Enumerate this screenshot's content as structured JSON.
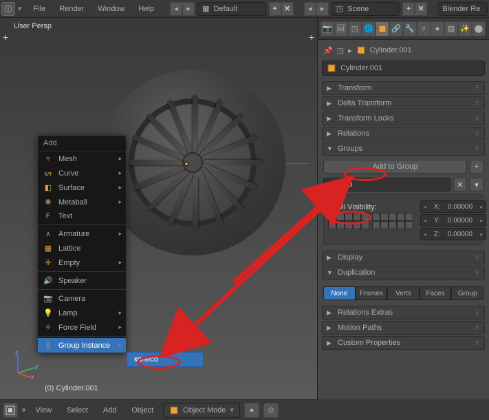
{
  "menubar": {
    "items": [
      "File",
      "Render",
      "Window",
      "Help"
    ],
    "layout_label": "Default",
    "scene_label": "Scene",
    "engine_label": "Blender Re"
  },
  "viewport": {
    "projection": "User Persp",
    "footer": "(0) Cylinder.001"
  },
  "add_menu": {
    "title": "Add",
    "items": [
      {
        "icon": "▿",
        "label": "Mesh",
        "sub": true
      },
      {
        "icon": "ᔕ",
        "label": "Curve",
        "sub": true
      },
      {
        "icon": "◧",
        "label": "Surface",
        "sub": true
      },
      {
        "icon": "❋",
        "label": "Metaball",
        "sub": true
      },
      {
        "icon": "F",
        "label": "Text",
        "sub": false
      }
    ],
    "items2": [
      {
        "icon": "⋏",
        "label": "Armature",
        "sub": true
      },
      {
        "icon": "▦",
        "label": "Lattice",
        "sub": false
      },
      {
        "icon": "✛",
        "label": "Empty",
        "sub": true
      }
    ],
    "items3": [
      {
        "icon": "🔊",
        "label": "Speaker",
        "sub": false
      }
    ],
    "items4": [
      {
        "icon": "📷",
        "label": "Camera",
        "sub": false
      },
      {
        "icon": "💡",
        "label": "Lamp",
        "sub": true
      },
      {
        "icon": "⟡",
        "label": "Force Field",
        "sub": true
      }
    ],
    "items5": [
      {
        "icon": "⟠",
        "label": "Group Instance",
        "sub": true
      }
    ],
    "submenu_label": "колесо"
  },
  "view_header": {
    "menus": [
      "View",
      "Select",
      "Add",
      "Object"
    ],
    "mode": "Object Mode"
  },
  "props": {
    "breadcrumb_name": "Cylinder.001",
    "object_name": "Cylinder.001",
    "panels": {
      "transform": "Transform",
      "delta": "Delta Transform",
      "locks": "Transform Locks",
      "relations": "Relations",
      "groups": "Groups",
      "display": "Display",
      "duplication": "Duplication",
      "rel_extras": "Relations Extras",
      "motion": "Motion Paths",
      "custom": "Custom Properties"
    },
    "groups": {
      "add_btn": "Add to Group",
      "group_name": "колесо",
      "dupli_label": "Dupli Visibility:",
      "coords": [
        {
          "axis": "X:",
          "val": "0.00000"
        },
        {
          "axis": "Y:",
          "val": "0.00000"
        },
        {
          "axis": "Z:",
          "val": "0.00000"
        }
      ]
    },
    "duplication": {
      "options": [
        "None",
        "Frames",
        "Verts",
        "Faces",
        "Group"
      ],
      "active": "None"
    }
  }
}
